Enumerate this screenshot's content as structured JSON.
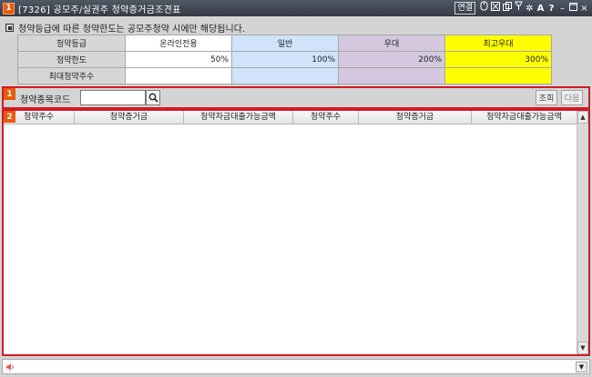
{
  "window": {
    "badge": "1",
    "title": "[7326] 공모주/실권주 청약증거금조견표",
    "link_label": "연결",
    "icon_names": [
      "mouse-icon",
      "close-small-icon",
      "window-copy-icon",
      "pin-icon",
      "settings-icon",
      "font-size-icon",
      "help-icon",
      "minimize-icon",
      "maximize-icon",
      "close-icon"
    ]
  },
  "notice": {
    "text": "청약등급에 따른 청약한도는 공모주청약 시에만 해당됩니다."
  },
  "rate_table": {
    "headers": [
      "청약등급",
      "온라인전용",
      "일반",
      "우대",
      "최고우대"
    ],
    "row_limit": {
      "label": "청약한도",
      "values": [
        "50%",
        "100%",
        "200%",
        "300%"
      ]
    },
    "row_max": {
      "label": "최대청약주수",
      "values": [
        "",
        "",
        "",
        ""
      ]
    },
    "colors": {
      "online": "#ffffff",
      "general": "#cfe3fb",
      "preferred": "#d3c8de",
      "top": "#ffff00"
    }
  },
  "search_panel": {
    "badge": "1",
    "label": "청약종목코드",
    "input_value": "",
    "query_label": "조회",
    "next_label": "다음"
  },
  "result_panel": {
    "badge": "2",
    "columns": [
      "청약주수",
      "청약증거금",
      "청약자금대출가능금액",
      "청약주수",
      "청약증거금",
      "청약자금대출가능금액"
    ],
    "rows": []
  },
  "status": {
    "message": ""
  },
  "colors": {
    "accent_red": "#d11b24",
    "badge_orange": "#e8590c"
  }
}
